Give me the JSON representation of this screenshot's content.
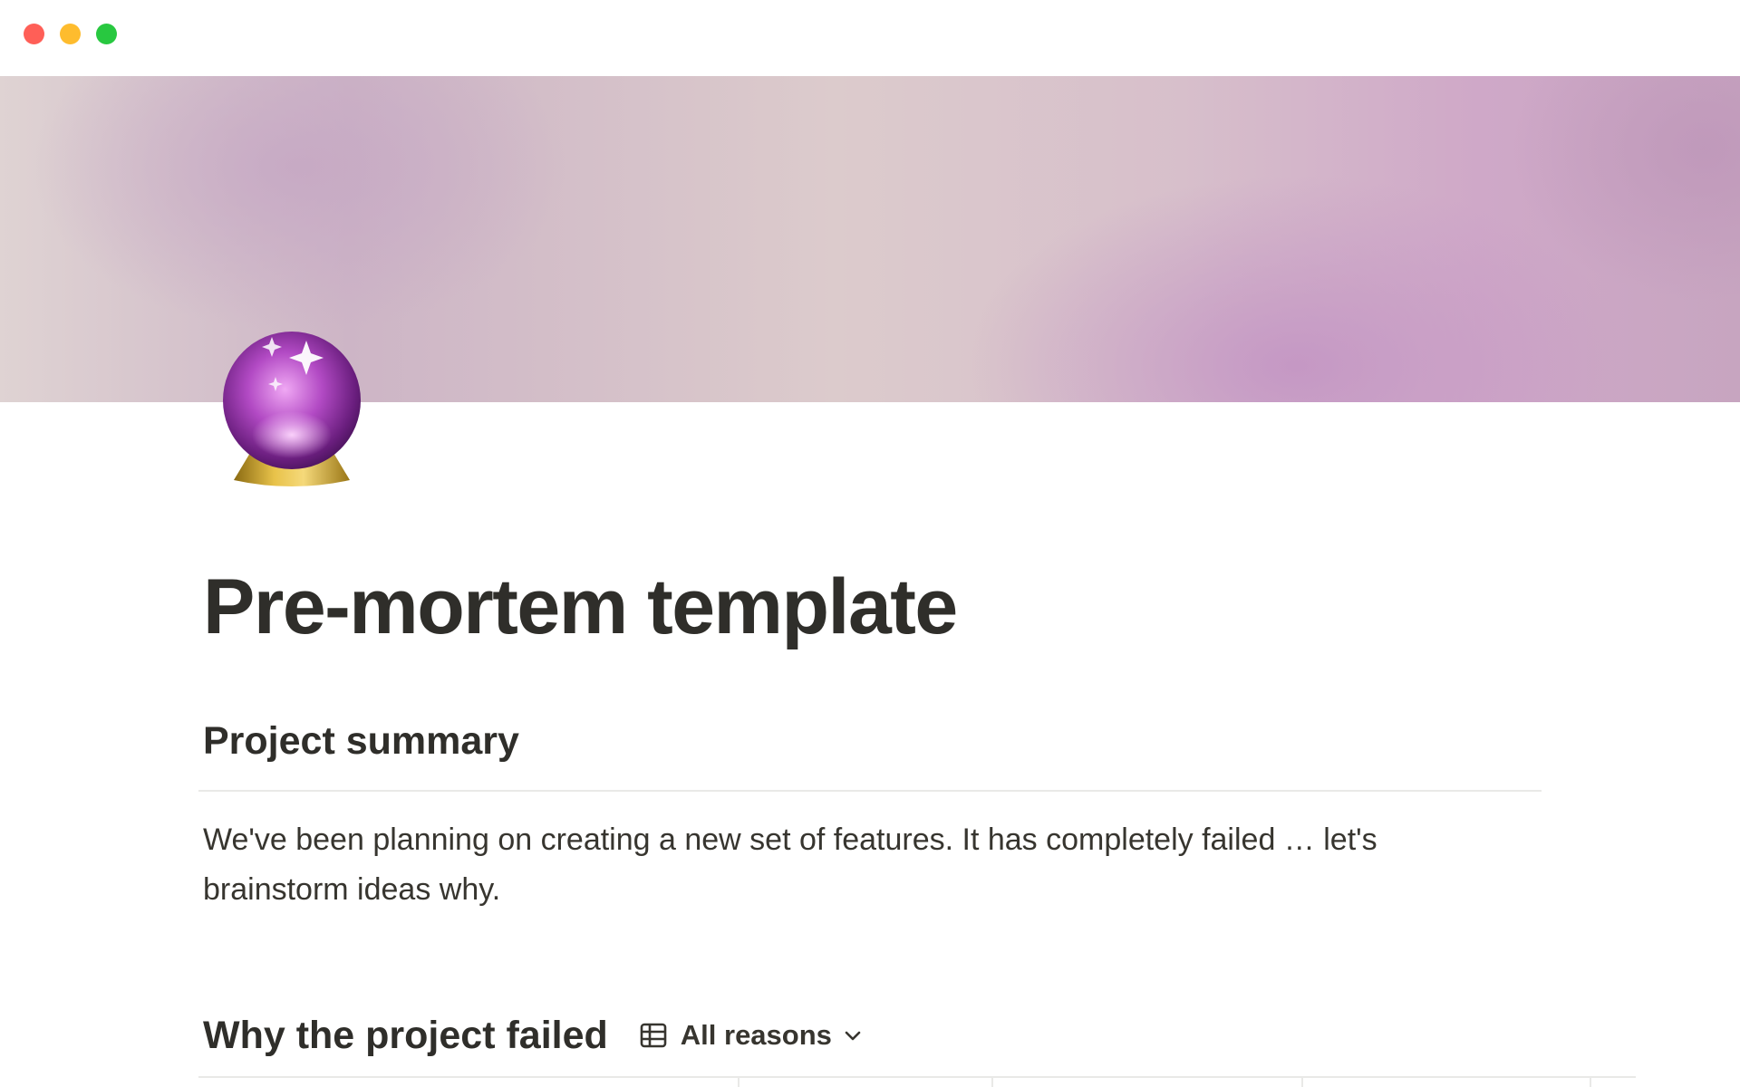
{
  "window": {
    "controls": [
      "close",
      "minimize",
      "zoom"
    ],
    "colors": {
      "close": "#ff5f57",
      "minimize": "#febc2e",
      "zoom": "#28c840"
    }
  },
  "page": {
    "icon": "crystal-ball-icon",
    "title": "Pre-mortem template"
  },
  "summary": {
    "heading": "Project summary",
    "text": "We've been planning on creating a new set of features. It has completely failed … let's brainstorm ideas why."
  },
  "failed": {
    "heading": "Why the project failed",
    "view_icon": "table-icon",
    "view_label": "All reasons",
    "chevron_icon": "chevron-down-icon"
  },
  "colors": {
    "text": "#37352f",
    "divider": "#e9e9e7",
    "cover_accent": "#c7a5c0"
  }
}
